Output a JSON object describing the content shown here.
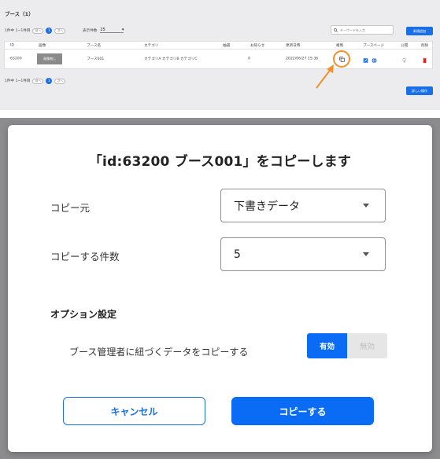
{
  "list": {
    "title": "ブース（1）",
    "pager_info": "1件中 1~1件目",
    "pager_prev": "前へ",
    "pager_next": "次へ",
    "pager_current": "1",
    "page_size_label": "表示件数",
    "page_size_value": "25",
    "search_placeholder": "キーワードを入力",
    "new_button": "新規追加",
    "detail_button": "詳しい操作",
    "columns": [
      "ID",
      "画像",
      "ブース名",
      "カテゴリ",
      "抽選",
      "お知らせ",
      "更新日時",
      "複製",
      "ブースページ",
      "公開",
      "削除"
    ],
    "row": {
      "id": "63200",
      "image_label": "画像無し",
      "name": "ブース001",
      "category": "カテゴリA カテゴリB カテゴリC",
      "notice": "0",
      "updated": "2022/06/27 15:36"
    },
    "accent_color": "#1a6fe6",
    "highlight_color": "#f0902a"
  },
  "modal": {
    "title": "「id:63200 ブース001」をコピーします",
    "source_label": "コピー元",
    "source_value": "下書きデータ",
    "count_label": "コピーする件数",
    "count_value": "5",
    "option_heading": "オプション設定",
    "option_label": "ブース管理者に紐づくデータをコピーする",
    "toggle_on": "有効",
    "toggle_off": "無効",
    "cancel_label": "キャンセル",
    "submit_label": "コピーする",
    "primary_color": "#0a6cf5"
  }
}
